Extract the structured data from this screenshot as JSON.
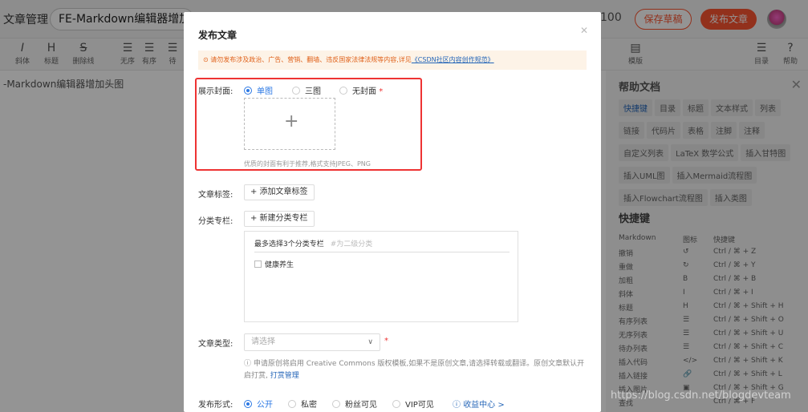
{
  "header": {
    "brand": "文章管理",
    "title_value": "FE-Markdown编辑器增加头",
    "word_count": "100",
    "save_label": "保存草稿",
    "publish_label": "发布文章"
  },
  "toolbar": {
    "left_items": [
      {
        "icon": "I",
        "label": "斜体"
      },
      {
        "icon": "H",
        "label": "标题"
      },
      {
        "icon": "S",
        "label": "删除线"
      },
      {
        "icon": "☰",
        "label": "无序"
      },
      {
        "icon": "☰",
        "label": "有序"
      },
      {
        "icon": "☰",
        "label": "待"
      }
    ],
    "right_items": [
      {
        "icon": "▤",
        "label": "模版"
      },
      {
        "icon": "☰",
        "label": "目录"
      },
      {
        "icon": "?",
        "label": "帮助"
      }
    ]
  },
  "editor": {
    "content": "-Markdown编辑器增加头图"
  },
  "help": {
    "title": "帮助文档",
    "tags": [
      "快捷键",
      "目录",
      "标题",
      "文本样式",
      "列表",
      "链接",
      "代码片",
      "表格",
      "注脚",
      "注释",
      "自定义列表",
      "LaTeX 数学公式",
      "插入甘特图",
      "插入UML图",
      "插入Mermaid流程图",
      "插入Flowchart流程图",
      "插入类图"
    ],
    "shortcut_title": "快捷键",
    "shortcut_header": [
      "Markdown",
      "图标",
      "快捷键"
    ],
    "shortcuts": [
      [
        "撤销",
        "↺",
        "Ctrl / ⌘ + Z"
      ],
      [
        "重做",
        "↻",
        "Ctrl / ⌘ + Y"
      ],
      [
        "加粗",
        "B",
        "Ctrl / ⌘ + B"
      ],
      [
        "斜体",
        "I",
        "Ctrl / ⌘ + I"
      ],
      [
        "标题",
        "H",
        "Ctrl / ⌘ + Shift + H"
      ],
      [
        "有序列表",
        "☰",
        "Ctrl / ⌘ + Shift + O"
      ],
      [
        "无序列表",
        "☰",
        "Ctrl / ⌘ + Shift + U"
      ],
      [
        "待办列表",
        "☰",
        "Ctrl / ⌘ + Shift + C"
      ],
      [
        "插入代码",
        "</>",
        "Ctrl / ⌘ + Shift + K"
      ],
      [
        "插入链接",
        "🔗",
        "Ctrl / ⌘ + Shift + L"
      ],
      [
        "插入图片",
        "▣",
        "Ctrl / ⌘ + Shift + G"
      ],
      [
        "查找",
        "",
        "Ctrl / ⌘ + F"
      ]
    ]
  },
  "modal": {
    "title": "发布文章",
    "warning_text": "请勿发布涉及政治、广告、营销、翻墙、违反国家法律法规等内容,详见",
    "warning_link": "《CSDN社区内容创作规范》",
    "cover_label": "展示封面:",
    "cover_options": [
      "单图",
      "三图",
      "无封面"
    ],
    "cover_hint": "优质的封面有利于推荐,格式支持JPEG、PNG",
    "tag_label": "文章标签:",
    "tag_button": "+ 添加文章标签",
    "category_label": "分类专栏:",
    "category_button": "+ 新建分类专栏",
    "category_max": "最多选择3个分类专栏",
    "category_placeholder": "#为二级分类",
    "category_item": "健康养生",
    "type_label": "文章类型:",
    "type_placeholder": "请选择",
    "note_text": "申请原创将启用 Creative Commons 版权模板,如果不是原创文章,请选择转载或翻译。原创文章默认开启打赏,",
    "note_link": "打赏管理",
    "publish_label": "发布形式:",
    "publish_options": [
      "公开",
      "私密",
      "粉丝可见",
      "VIP可见"
    ],
    "income_link": "收益中心 >"
  },
  "watermark": "https://blog.csdn.net/blogdevteam",
  "colors": {
    "accent": "#fc5531",
    "link": "#2566b8",
    "selected": "#2b78e4"
  }
}
